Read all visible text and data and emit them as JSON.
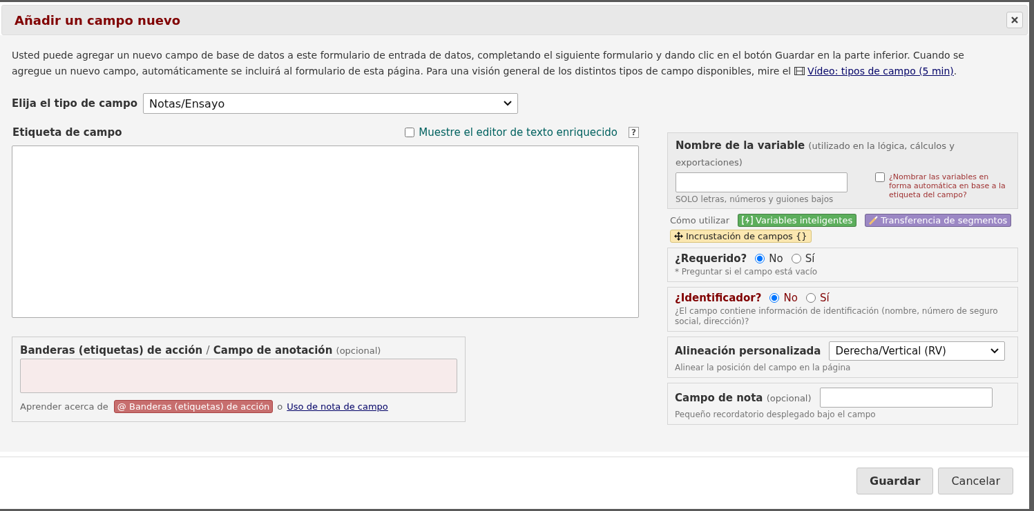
{
  "dialog": {
    "title": "Añadir un campo nuevo"
  },
  "intro": {
    "text": "Usted puede agregar un nuevo campo de base de datos a este formulario de entrada de datos, completando el siguiente formulario y dando clic en el botón Guardar en la parte inferior. Cuando se agregue un nuevo campo, automáticamente se incluirá al formulario de esta página. Para una visión general de los distintos tipos de campo disponibles, mire el",
    "link": "Vídeo: tipos de campo (5 min)",
    "end": "."
  },
  "field_type": {
    "label": "Elija el tipo de campo",
    "value": "Notas/Ensayo"
  },
  "field_label": {
    "label": "Etiqueta de campo",
    "rich_editor": {
      "label": "Muestre el editor de texto enriquecido",
      "checked": false
    },
    "help": "?"
  },
  "action_tags": {
    "title": "Banderas (etiquetas) de acción",
    "separator": "/",
    "title2": "Campo de anotación",
    "optional": "(opcional)",
    "learn": "Aprender acerca de",
    "badge": "@ Banderas (etiquetas) de acción",
    "or": "o",
    "link": "Uso de nota de campo"
  },
  "variable": {
    "title": "Nombre de la variable",
    "note": "(utilizado en la lógica, cálculos y exportaciones)",
    "hint": "SOLO letras, números y guiones bajos",
    "auto": {
      "label": "¿Nombrar las variables en forma automática en base a la etiqueta del campo?",
      "checked": false
    }
  },
  "how_to": {
    "label": "Cómo utilizar",
    "badges": [
      {
        "kind": "smart",
        "text": "Variables inteligentes",
        "color": "#5cae5c"
      },
      {
        "kind": "piping",
        "text": "Transferencia de segmentos",
        "color": "#9b87c4"
      },
      {
        "kind": "embed",
        "text": "Incrustación de campos {}",
        "color": "#fbe7b0"
      }
    ]
  },
  "required": {
    "label": "¿Requerido?",
    "options": [
      {
        "label": "No",
        "selected": true
      },
      {
        "label": "Sí",
        "selected": false
      }
    ],
    "hint": "* Preguntar si el campo está vacío"
  },
  "identifier": {
    "label": "¿Identificador?",
    "options": [
      {
        "label": "No",
        "selected": true
      },
      {
        "label": "Sí",
        "selected": false
      }
    ],
    "hint": "¿El campo contiene información de identificación (nombre, número de seguro social, dirección)?"
  },
  "alignment": {
    "label": "Alineación personalizada",
    "value": "Derecha/Vertical (RV)",
    "hint": "Alinear la posición del campo en la página"
  },
  "field_note": {
    "label": "Campo de nota",
    "optional": "(opcional)",
    "hint": "Pequeño recordatorio desplegado bajo el campo"
  },
  "buttons": [
    {
      "label": "Guardar",
      "kind": "primary"
    },
    {
      "label": "Cancelar",
      "kind": "secondary"
    }
  ]
}
